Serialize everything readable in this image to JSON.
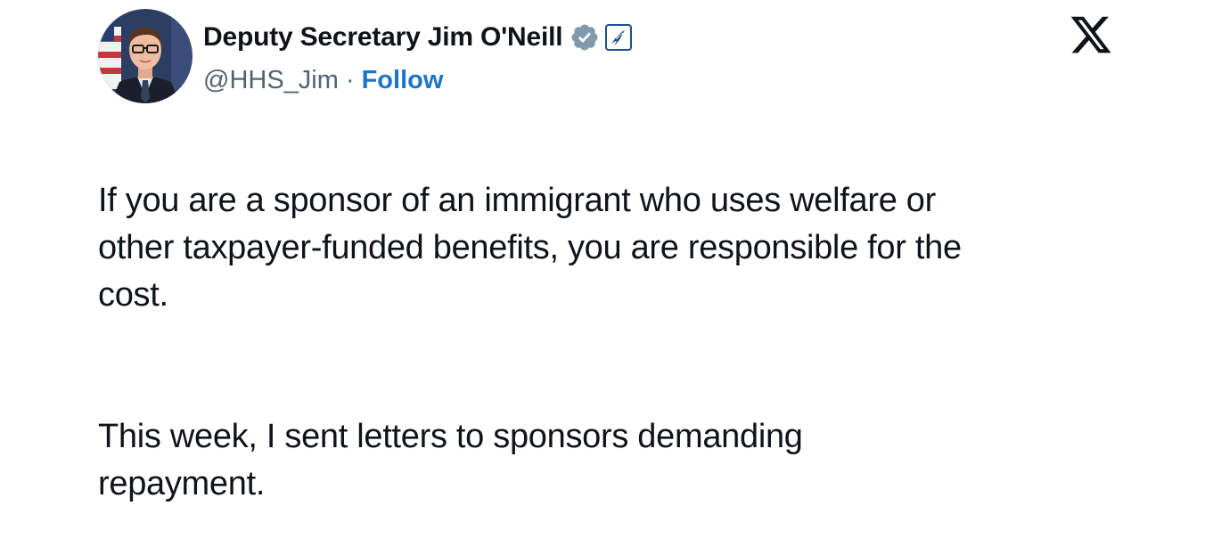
{
  "author": {
    "display_name": "Deputy Secretary Jim O'Neill",
    "handle": "@HHS_Jim",
    "separator": "·",
    "follow_label": "Follow",
    "verified_badge_icon": "verified-badge-icon",
    "affiliate_badge_icon": "hhs-eagle-icon"
  },
  "platform_logo_icon": "x-logo-icon",
  "tweet": {
    "paragraphs": [
      "If you are a sponsor of an immigrant who uses welfare or\nother taxpayer-funded benefits, you are responsible for the\ncost.",
      "This week, I sent letters to sponsors demanding\nrepayment."
    ]
  },
  "colors": {
    "text": "#0f1419",
    "secondary_text": "#536471",
    "follow_link": "#1d74c8",
    "verified_badge": "#829aab"
  }
}
